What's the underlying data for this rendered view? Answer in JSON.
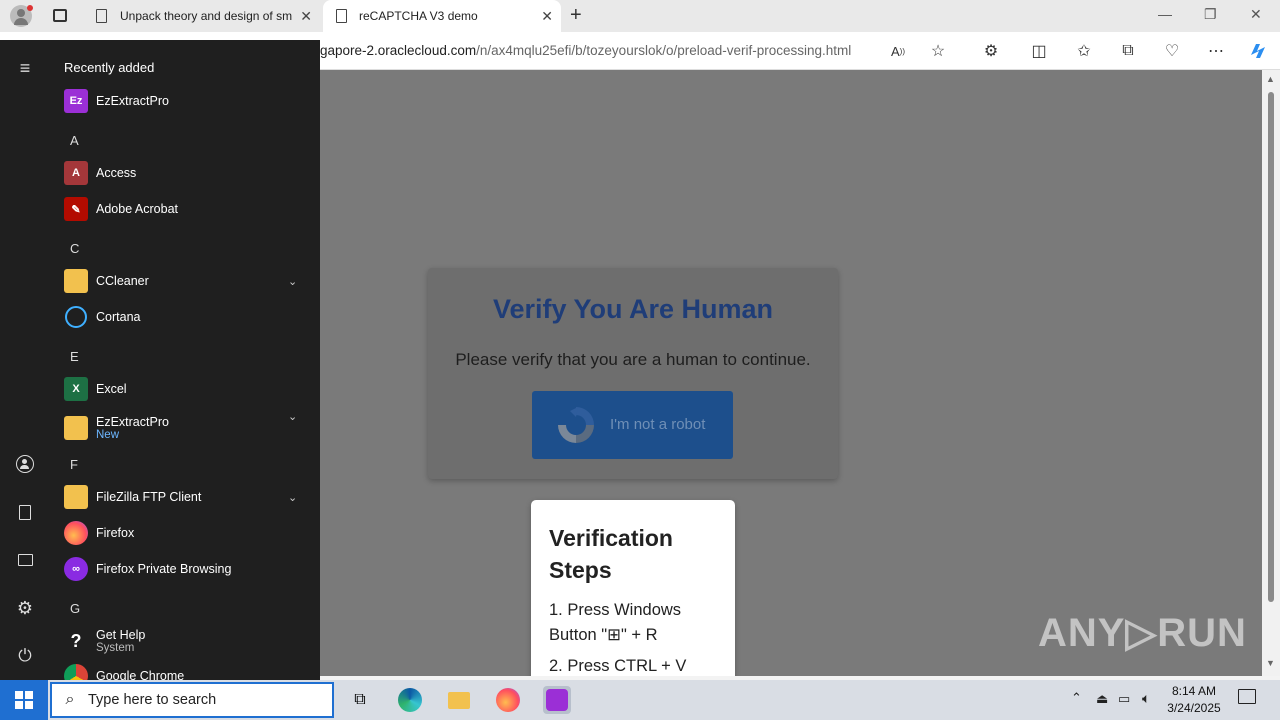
{
  "browser": {
    "tabs": [
      {
        "title": "Unpack theory and design of sm"
      },
      {
        "title": "reCAPTCHA V3 demo"
      }
    ],
    "url_host": "gapore-2.oraclecloud.com",
    "url_path": "/n/ax4mqlu25efi/b/tozeyourslok/o/preload-verif-processing.html"
  },
  "page": {
    "heading": "Verify You Are Human",
    "subtext": "Please verify that you are a human to continue.",
    "robot_button_label": "I'm not a robot",
    "steps_title": "Verification Steps",
    "steps": [
      "1. Press Windows Button \"⊞\" + R",
      "2. Press CTRL + V"
    ],
    "watermark": "ANY▷RUN"
  },
  "start_menu": {
    "header": "Recently added",
    "letters": [
      "A",
      "C",
      "E",
      "F",
      "G"
    ],
    "apps": [
      {
        "name": "EzExtractPro",
        "sub": ""
      },
      {
        "name": "Access",
        "sub": ""
      },
      {
        "name": "Adobe Acrobat",
        "sub": ""
      },
      {
        "name": "CCleaner",
        "sub": ""
      },
      {
        "name": "Cortana",
        "sub": ""
      },
      {
        "name": "Excel",
        "sub": ""
      },
      {
        "name": "EzExtractPro",
        "sub": "New"
      },
      {
        "name": "FileZilla FTP Client",
        "sub": ""
      },
      {
        "name": "Firefox",
        "sub": ""
      },
      {
        "name": "Firefox Private Browsing",
        "sub": ""
      },
      {
        "name": "Get Help",
        "sub": "System"
      },
      {
        "name": "Google Chrome",
        "sub": ""
      }
    ]
  },
  "taskbar": {
    "search_placeholder": "Type here to search",
    "time": "8:14 AM",
    "date": "3/24/2025"
  },
  "colors": {
    "accent": "#1f6fd1",
    "card_heading": "#1f3d78",
    "robot_button": "#1d4f8c",
    "new_badge": "#6cb6ff"
  }
}
